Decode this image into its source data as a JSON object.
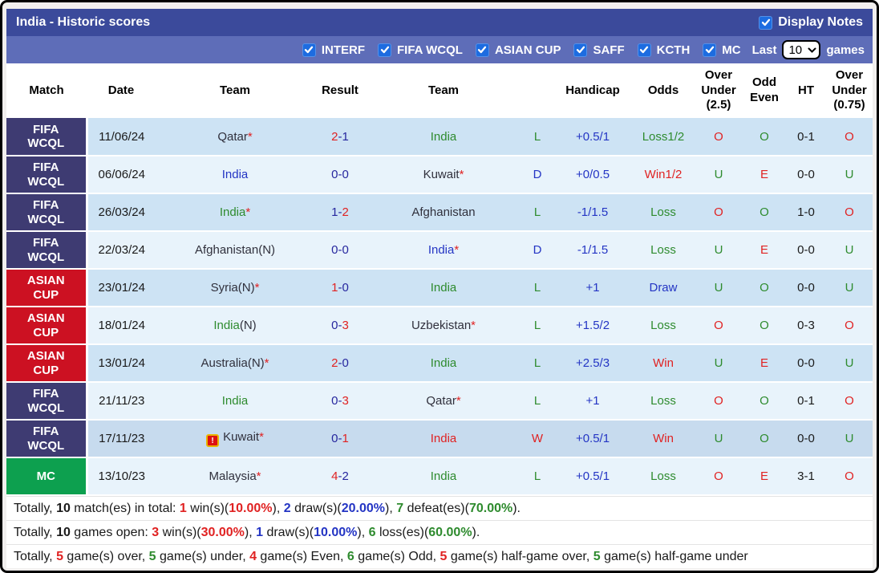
{
  "header": {
    "title": "India - Historic scores",
    "display_notes_label": "Display Notes"
  },
  "filters": {
    "items": [
      "INTERF",
      "FIFA WCQL",
      "ASIAN CUP",
      "SAFF",
      "KCTH",
      "MC"
    ],
    "last_label": "Last",
    "selected_count": "10",
    "games_label": "games"
  },
  "icons": {
    "checkbox_check": "check",
    "select_arrow": "chevron-down",
    "note_glyph": "!"
  },
  "colors": {
    "titlebar": "#3b4a9b",
    "filterbar": "#5e6db8",
    "checkbox_blue": "#1d6ce0",
    "fifa_wcql_bg": "#3e3b72",
    "asian_cup_bg": "#cc1122",
    "mc_bg": "#0da04f",
    "win_red": "#e02222",
    "loss_green": "#2e8b2e",
    "draw_blue": "#2435c4",
    "score_navy": "#26269e"
  },
  "table": {
    "columns": [
      "Match",
      "Date",
      "Team",
      "Result",
      "Team",
      "",
      "Handicap",
      "Odds",
      "Over Under (2.5)",
      "Odd Even",
      "HT",
      "Over Under (0.75)"
    ],
    "rows": [
      {
        "comp": "FIFA WCQL",
        "comp_type": "fifa",
        "date": "11/06/24",
        "home": {
          "name": "Qatar",
          "suffix": "",
          "star": true,
          "color": "dark",
          "note": false
        },
        "score": {
          "left": "2",
          "left_color": "red",
          "right": "1",
          "right_color": "navy"
        },
        "away": {
          "name": "India",
          "suffix": "",
          "star": false,
          "color": "green",
          "note": false
        },
        "ldw": {
          "t": "L",
          "c": "green"
        },
        "handicap": "+0.5/1",
        "odds": {
          "t": "Loss1/2",
          "c": "green"
        },
        "ou25": {
          "t": "O",
          "c": "red"
        },
        "odd_even": {
          "t": "O",
          "c": "green"
        },
        "ht": "0-1",
        "ou075": {
          "t": "O",
          "c": "red"
        },
        "shade": "dark"
      },
      {
        "comp": "FIFA WCQL",
        "comp_type": "fifa",
        "date": "06/06/24",
        "home": {
          "name": "India",
          "suffix": "",
          "star": false,
          "color": "blue",
          "note": false
        },
        "score": {
          "left": "0",
          "left_color": "navy",
          "right": "0",
          "right_color": "navy"
        },
        "away": {
          "name": "Kuwait",
          "suffix": "",
          "star": true,
          "color": "dark",
          "note": false
        },
        "ldw": {
          "t": "D",
          "c": "blue"
        },
        "handicap": "+0/0.5",
        "odds": {
          "t": "Win1/2",
          "c": "red"
        },
        "ou25": {
          "t": "U",
          "c": "green"
        },
        "odd_even": {
          "t": "E",
          "c": "red"
        },
        "ht": "0-0",
        "ou075": {
          "t": "U",
          "c": "green"
        },
        "shade": "light"
      },
      {
        "comp": "FIFA WCQL",
        "comp_type": "fifa",
        "date": "26/03/24",
        "home": {
          "name": "India",
          "suffix": "",
          "star": true,
          "color": "green",
          "note": false
        },
        "score": {
          "left": "1",
          "left_color": "navy",
          "right": "2",
          "right_color": "red"
        },
        "away": {
          "name": "Afghanistan",
          "suffix": "",
          "star": false,
          "color": "dark",
          "note": false
        },
        "ldw": {
          "t": "L",
          "c": "green"
        },
        "handicap": "-1/1.5",
        "odds": {
          "t": "Loss",
          "c": "green"
        },
        "ou25": {
          "t": "O",
          "c": "red"
        },
        "odd_even": {
          "t": "O",
          "c": "green"
        },
        "ht": "1-0",
        "ou075": {
          "t": "O",
          "c": "red"
        },
        "shade": "dark"
      },
      {
        "comp": "FIFA WCQL",
        "comp_type": "fifa",
        "date": "22/03/24",
        "home": {
          "name": "Afghanistan",
          "suffix": "(N)",
          "star": false,
          "color": "dark",
          "note": false
        },
        "score": {
          "left": "0",
          "left_color": "navy",
          "right": "0",
          "right_color": "navy"
        },
        "away": {
          "name": "India",
          "suffix": "",
          "star": true,
          "color": "blue",
          "note": false
        },
        "ldw": {
          "t": "D",
          "c": "blue"
        },
        "handicap": "-1/1.5",
        "odds": {
          "t": "Loss",
          "c": "green"
        },
        "ou25": {
          "t": "U",
          "c": "green"
        },
        "odd_even": {
          "t": "E",
          "c": "red"
        },
        "ht": "0-0",
        "ou075": {
          "t": "U",
          "c": "green"
        },
        "shade": "light"
      },
      {
        "comp": "ASIAN CUP",
        "comp_type": "asian",
        "date": "23/01/24",
        "home": {
          "name": "Syria",
          "suffix": "(N)",
          "star": true,
          "color": "dark",
          "note": false
        },
        "score": {
          "left": "1",
          "left_color": "red",
          "right": "0",
          "right_color": "navy"
        },
        "away": {
          "name": "India",
          "suffix": "",
          "star": false,
          "color": "green",
          "note": false
        },
        "ldw": {
          "t": "L",
          "c": "green"
        },
        "handicap": "+1",
        "odds": {
          "t": "Draw",
          "c": "blue"
        },
        "ou25": {
          "t": "U",
          "c": "green"
        },
        "odd_even": {
          "t": "O",
          "c": "green"
        },
        "ht": "0-0",
        "ou075": {
          "t": "U",
          "c": "green"
        },
        "shade": "dark"
      },
      {
        "comp": "ASIAN CUP",
        "comp_type": "asian",
        "date": "18/01/24",
        "home": {
          "name": "India",
          "suffix": "(N)",
          "star": false,
          "color": "green",
          "note": false
        },
        "score": {
          "left": "0",
          "left_color": "navy",
          "right": "3",
          "right_color": "red"
        },
        "away": {
          "name": "Uzbekistan",
          "suffix": "",
          "star": true,
          "color": "dark",
          "note": false
        },
        "ldw": {
          "t": "L",
          "c": "green"
        },
        "handicap": "+1.5/2",
        "odds": {
          "t": "Loss",
          "c": "green"
        },
        "ou25": {
          "t": "O",
          "c": "red"
        },
        "odd_even": {
          "t": "O",
          "c": "green"
        },
        "ht": "0-3",
        "ou075": {
          "t": "O",
          "c": "red"
        },
        "shade": "light"
      },
      {
        "comp": "ASIAN CUP",
        "comp_type": "asian",
        "date": "13/01/24",
        "home": {
          "name": "Australia",
          "suffix": "(N)",
          "star": true,
          "color": "dark",
          "note": false
        },
        "score": {
          "left": "2",
          "left_color": "red",
          "right": "0",
          "right_color": "navy"
        },
        "away": {
          "name": "India",
          "suffix": "",
          "star": false,
          "color": "green",
          "note": false
        },
        "ldw": {
          "t": "L",
          "c": "green"
        },
        "handicap": "+2.5/3",
        "odds": {
          "t": "Win",
          "c": "red"
        },
        "ou25": {
          "t": "U",
          "c": "green"
        },
        "odd_even": {
          "t": "E",
          "c": "red"
        },
        "ht": "0-0",
        "ou075": {
          "t": "U",
          "c": "green"
        },
        "shade": "dark"
      },
      {
        "comp": "FIFA WCQL",
        "comp_type": "fifa",
        "date": "21/11/23",
        "home": {
          "name": "India",
          "suffix": "",
          "star": false,
          "color": "green",
          "note": false
        },
        "score": {
          "left": "0",
          "left_color": "navy",
          "right": "3",
          "right_color": "red"
        },
        "away": {
          "name": "Qatar",
          "suffix": "",
          "star": true,
          "color": "dark",
          "note": false
        },
        "ldw": {
          "t": "L",
          "c": "green"
        },
        "handicap": "+1",
        "odds": {
          "t": "Loss",
          "c": "green"
        },
        "ou25": {
          "t": "O",
          "c": "red"
        },
        "odd_even": {
          "t": "O",
          "c": "green"
        },
        "ht": "0-1",
        "ou075": {
          "t": "O",
          "c": "red"
        },
        "shade": "light"
      },
      {
        "comp": "FIFA WCQL",
        "comp_type": "fifa",
        "date": "17/11/23",
        "home": {
          "name": "Kuwait",
          "suffix": "",
          "star": true,
          "color": "dark",
          "note": true
        },
        "score": {
          "left": "0",
          "left_color": "navy",
          "right": "1",
          "right_color": "red"
        },
        "away": {
          "name": "India",
          "suffix": "",
          "star": false,
          "color": "red",
          "note": false
        },
        "ldw": {
          "t": "W",
          "c": "red"
        },
        "handicap": "+0.5/1",
        "odds": {
          "t": "Win",
          "c": "red"
        },
        "ou25": {
          "t": "U",
          "c": "green"
        },
        "odd_even": {
          "t": "O",
          "c": "green"
        },
        "ht": "0-0",
        "ou075": {
          "t": "U",
          "c": "green"
        },
        "shade": "highlight"
      },
      {
        "comp": "MC",
        "comp_type": "mc",
        "date": "13/10/23",
        "home": {
          "name": "Malaysia",
          "suffix": "",
          "star": true,
          "color": "dark",
          "note": false
        },
        "score": {
          "left": "4",
          "left_color": "red",
          "right": "2",
          "right_color": "navy"
        },
        "away": {
          "name": "India",
          "suffix": "",
          "star": false,
          "color": "green",
          "note": false
        },
        "ldw": {
          "t": "L",
          "c": "green"
        },
        "handicap": "+0.5/1",
        "odds": {
          "t": "Loss",
          "c": "green"
        },
        "ou25": {
          "t": "O",
          "c": "red"
        },
        "odd_even": {
          "t": "E",
          "c": "red"
        },
        "ht": "3-1",
        "ou075": {
          "t": "O",
          "c": "red"
        },
        "shade": "light"
      }
    ]
  },
  "footer": {
    "lines": [
      [
        {
          "t": "Totally, ",
          "c": "black"
        },
        {
          "t": "10",
          "c": "black",
          "b": true
        },
        {
          "t": " match(es) in total: ",
          "c": "black"
        },
        {
          "t": "1",
          "c": "red",
          "b": true
        },
        {
          "t": " win(s)(",
          "c": "black"
        },
        {
          "t": "10.00%",
          "c": "red",
          "b": true
        },
        {
          "t": "), ",
          "c": "black"
        },
        {
          "t": "2",
          "c": "blue",
          "b": true
        },
        {
          "t": " draw(s)(",
          "c": "black"
        },
        {
          "t": "20.00%",
          "c": "blue",
          "b": true
        },
        {
          "t": "), ",
          "c": "black"
        },
        {
          "t": "7",
          "c": "green",
          "b": true
        },
        {
          "t": " defeat(es)(",
          "c": "black"
        },
        {
          "t": "70.00%",
          "c": "green",
          "b": true
        },
        {
          "t": ").",
          "c": "black"
        }
      ],
      [
        {
          "t": "Totally, ",
          "c": "black"
        },
        {
          "t": "10",
          "c": "black",
          "b": true
        },
        {
          "t": " games open: ",
          "c": "black"
        },
        {
          "t": "3",
          "c": "red",
          "b": true
        },
        {
          "t": " win(s)(",
          "c": "black"
        },
        {
          "t": "30.00%",
          "c": "red",
          "b": true
        },
        {
          "t": "), ",
          "c": "black"
        },
        {
          "t": "1",
          "c": "blue",
          "b": true
        },
        {
          "t": " draw(s)(",
          "c": "black"
        },
        {
          "t": "10.00%",
          "c": "blue",
          "b": true
        },
        {
          "t": "), ",
          "c": "black"
        },
        {
          "t": "6",
          "c": "green",
          "b": true
        },
        {
          "t": " loss(es)(",
          "c": "black"
        },
        {
          "t": "60.00%",
          "c": "green",
          "b": true
        },
        {
          "t": ").",
          "c": "black"
        }
      ],
      [
        {
          "t": "Totally, ",
          "c": "black"
        },
        {
          "t": "5",
          "c": "red",
          "b": true
        },
        {
          "t": " game(s) over, ",
          "c": "black"
        },
        {
          "t": "5",
          "c": "green",
          "b": true
        },
        {
          "t": " game(s) under, ",
          "c": "black"
        },
        {
          "t": "4",
          "c": "red",
          "b": true
        },
        {
          "t": " game(s) Even, ",
          "c": "black"
        },
        {
          "t": "6",
          "c": "green",
          "b": true
        },
        {
          "t": " game(s) Odd, ",
          "c": "black"
        },
        {
          "t": "5",
          "c": "red",
          "b": true
        },
        {
          "t": " game(s) half-game over, ",
          "c": "black"
        },
        {
          "t": "5",
          "c": "green",
          "b": true
        },
        {
          "t": " game(s) half-game under",
          "c": "black"
        }
      ]
    ]
  }
}
